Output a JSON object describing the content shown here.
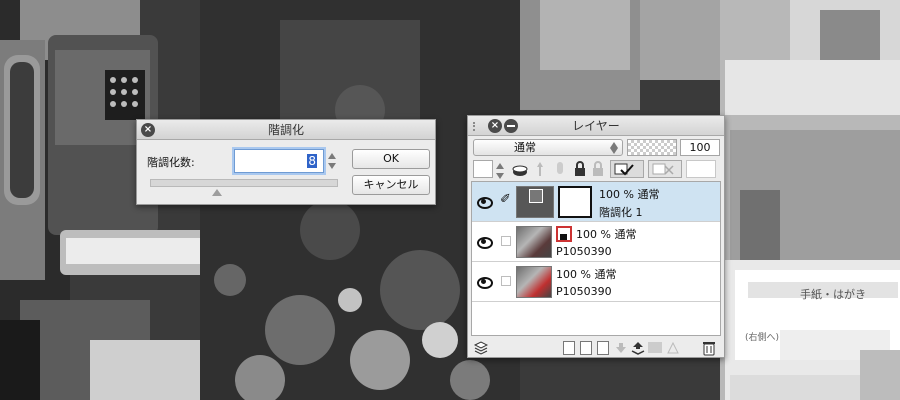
{
  "posterize_dialog": {
    "title": "階調化",
    "levels_label": "階調化数:",
    "levels_value": "8",
    "ok_label": "OK",
    "cancel_label": "キャンセル"
  },
  "layer_panel": {
    "title": "レイヤー",
    "blend_mode": "通常",
    "opacity": "100",
    "layers": [
      {
        "opacity_mode": "100 % 通常",
        "name": "階調化 1",
        "selected": true
      },
      {
        "opacity_mode": "100 % 通常",
        "name": "P1050390",
        "selected": false
      },
      {
        "opacity_mode": "100 % 通常",
        "name": "P1050390",
        "selected": false
      }
    ]
  },
  "colors": {
    "selection": "#cfe3f2",
    "text_highlight": "#2f63c8",
    "focus_ring": "#a9c8ef"
  }
}
